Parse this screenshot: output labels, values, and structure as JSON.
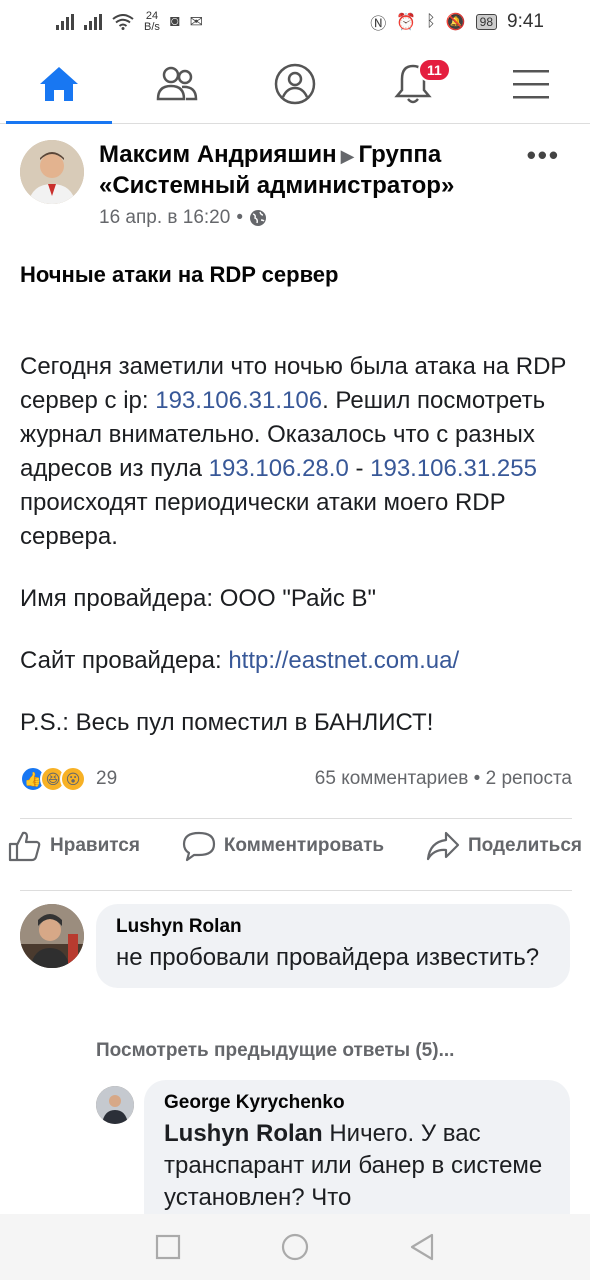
{
  "statusbar": {
    "net_speed_value": "24",
    "net_speed_unit": "B/s",
    "battery": "98",
    "time": "9:41"
  },
  "tabs": [
    {
      "name": "home",
      "icon": "home-icon",
      "active": true
    },
    {
      "name": "groups",
      "icon": "friends-icon"
    },
    {
      "name": "profile",
      "icon": "profile-icon"
    },
    {
      "name": "notifications",
      "icon": "bell-icon",
      "badge": "11"
    },
    {
      "name": "menu",
      "icon": "menu-icon"
    }
  ],
  "post": {
    "author": "Максим Андрияшин",
    "group": "Группа «Системный администратор»",
    "date": "16 апр. в 16:20",
    "title": "Ночные атаки на RDP сервер",
    "body_1_a": "Сегодня заметили что ночью была атака на RDP сервер с ip: ",
    "body_1_ip": "193.106.31.106",
    "body_1_b": ". Решил посмотреть журнал внимательно. Оказалось что с разных адресов из пула ",
    "body_1_range_start": "193.106.28.0",
    "body_1_dash": " - ",
    "body_1_range_end": "193.106.31.255",
    "body_1_c": " происходят периодически атаки моего RDP сервера.",
    "provider_name": "Имя провайдера: ООО \"Райс В\"",
    "provider_site_label": "Сайт провайдера: ",
    "provider_site_url": "http://eastnet.com.ua/",
    "ps": "P.S.: Весь пул поместил в БАНЛИСТ!"
  },
  "reactions": {
    "count": "29",
    "comments": "65 комментариев",
    "separator": "•",
    "shares": "2 репоста"
  },
  "actions": {
    "like": "Нравится",
    "comment": "Комментировать",
    "share": "Поделиться"
  },
  "comments": [
    {
      "author": "Lushyn Rolan",
      "text": "не пробовали провайдера известить?"
    }
  ],
  "previous_replies": "Посмотреть предыдущие ответы (5)...",
  "reply": {
    "author": "George Kyrychenko",
    "mention": "Lushyn Rolan",
    "text": " Ничего. У вас транспарант или банер в системе установлен? Что"
  },
  "colors": {
    "accent": "#1877f2",
    "link": "#385898",
    "badge": "#e41e3f"
  }
}
